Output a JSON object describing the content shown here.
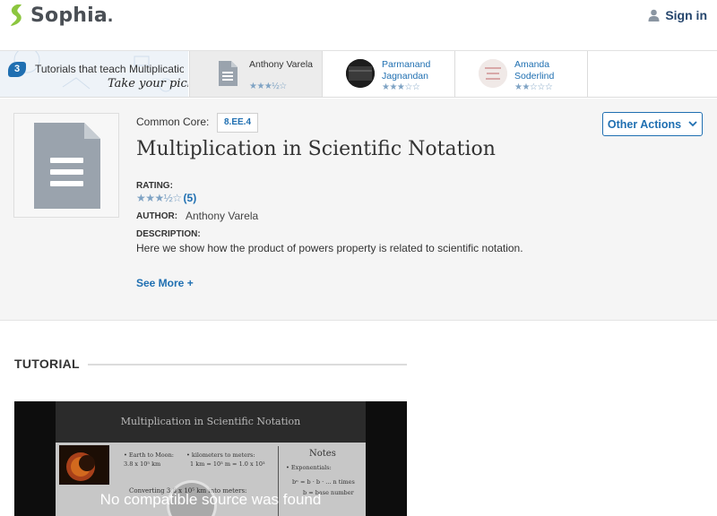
{
  "header": {
    "brand": "Sophia",
    "signin_label": "Sign in"
  },
  "tutorials_strip": {
    "count": "3",
    "title": "Tutorials that teach Multiplication in Scientific Notation",
    "pick_text": "Take your pick:",
    "tutors": [
      {
        "name": "Anthony Varela",
        "rating": 3.5,
        "stars": "★★★½☆",
        "active": true
      },
      {
        "name": "Parmanand Jagnandan",
        "rating": 3,
        "stars": "★★★☆☆",
        "active": false
      },
      {
        "name": "Amanda Soderlind",
        "rating": 2,
        "stars": "★★☆☆☆",
        "active": false
      }
    ]
  },
  "summary": {
    "common_core_label": "Common Core:",
    "common_core_code": "8.EE.4",
    "other_actions_label": "Other Actions",
    "title": "Multiplication in Scientific Notation",
    "rating_label": "RATING:",
    "rating_stars": "★★★½☆",
    "rating_value": 3.5,
    "rating_count": "(5)",
    "author_label": "AUTHOR:",
    "author_name": "Anthony Varela",
    "description_label": "DESCRIPTION:",
    "description": "Here we show how the product of powers property is related to scientific notation.",
    "see_more": "See More +"
  },
  "tutorial": {
    "heading": "TUTORIAL",
    "slide_title": "Multiplication in Scientific Notation",
    "slide_line1": "• Earth to Moon:",
    "slide_line2": "3.8 x 10⁵ km",
    "slide_line3": "• kilometers to meters:",
    "slide_line4": "1 km = 10³ m  = 1.0 x 10³",
    "slide_line5": "Converting 3.8 x 10⁵ km into meters:",
    "slide_notes": "Notes",
    "slide_note1": "• Exponentials:",
    "slide_note2": "bⁿ = b · b · ...  n times",
    "slide_note3": "b = base number",
    "video_message": "No compatible source was found"
  },
  "colors": {
    "brand_green": "#8cc63f",
    "link_blue": "#1f6fb1",
    "star_blue": "#7fa3c4"
  }
}
